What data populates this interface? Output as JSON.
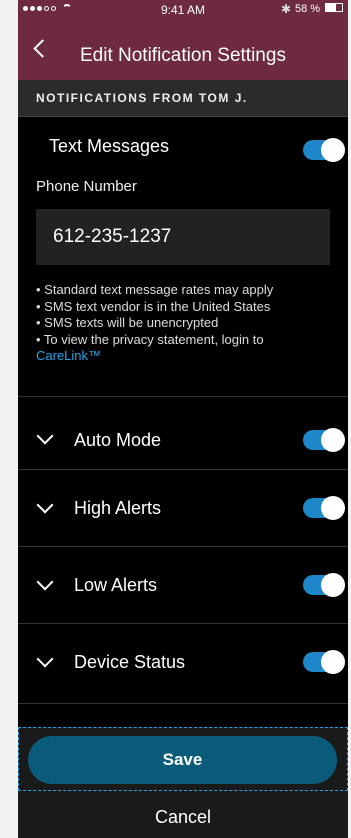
{
  "status_bar": {
    "time": "9:41 AM",
    "battery": "58 %",
    "bluetooth_icon": "bluetooth-icon"
  },
  "nav": {
    "title": "Edit Notification Settings",
    "back_icon": "chevron-left-icon"
  },
  "section": {
    "header": "NOTIFICATIONS FROM TOM J."
  },
  "text_messages": {
    "label": "Text Messages",
    "enabled": true,
    "phone_label": "Phone Number",
    "phone_value": "612-235-1237",
    "notes": [
      "• Standard text message rates may apply",
      "• SMS text vendor is in the United States",
      "• SMS texts will be unencrypted",
      "• To view the privacy statement, login to"
    ],
    "link": "CareLink™"
  },
  "rows": [
    {
      "label": "Auto Mode",
      "enabled": true
    },
    {
      "label": "High Alerts",
      "enabled": true
    },
    {
      "label": "Low Alerts",
      "enabled": true
    },
    {
      "label": "Device Status",
      "enabled": true
    }
  ],
  "footer": {
    "save_label": "Save",
    "cancel_label": "Cancel"
  },
  "colors": {
    "header_bg": "#6e2a3f",
    "toggle_on": "#1d87c9",
    "save_bg": "#0a5b7a",
    "link": "#2aa3e6"
  }
}
